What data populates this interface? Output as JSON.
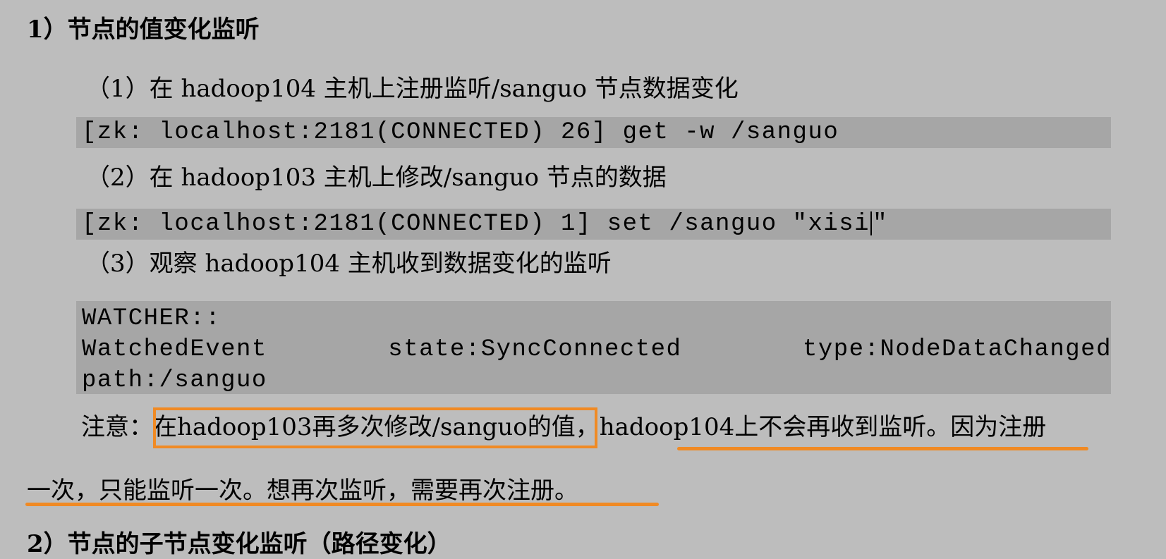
{
  "heading": "1）节点的值变化监听",
  "steps": [
    {
      "label": "（1）在 hadoop104 主机上注册监听/sanguo 节点数据变化",
      "code": "[zk: localhost:2181(CONNECTED) 26] get -w /sanguo"
    },
    {
      "label": "（2）在 hadoop103 主机上修改/sanguo 节点的数据",
      "code_before_caret": "[zk: localhost:2181(CONNECTED) 1] set /sanguo \"xisi",
      "code_after_caret": "\""
    },
    {
      "label": "（3）观察 hadoop104 主机收到数据变化的监听",
      "watcher_line1": "WATCHER::",
      "watcher_line2_parts": [
        "WatchedEvent",
        "state:SyncConnected",
        "type:NodeDataChanged"
      ],
      "watcher_line3": "path:/sanguo"
    }
  ],
  "note": {
    "prefix": "注意：",
    "boxed": "在hadoop103再多次修改/sanguo的值，",
    "rest": "hadoop104上不会再收到监听。因为注册",
    "line2": "一次，只能监听一次。想再次监听，需要再次注册。"
  },
  "cutoff_text": "2）节点的子节点变化监听（路径变化）",
  "colors": {
    "page_background": "#bdbdbd",
    "code_background": "#a6a6a6",
    "highlight": "#f08a24"
  }
}
